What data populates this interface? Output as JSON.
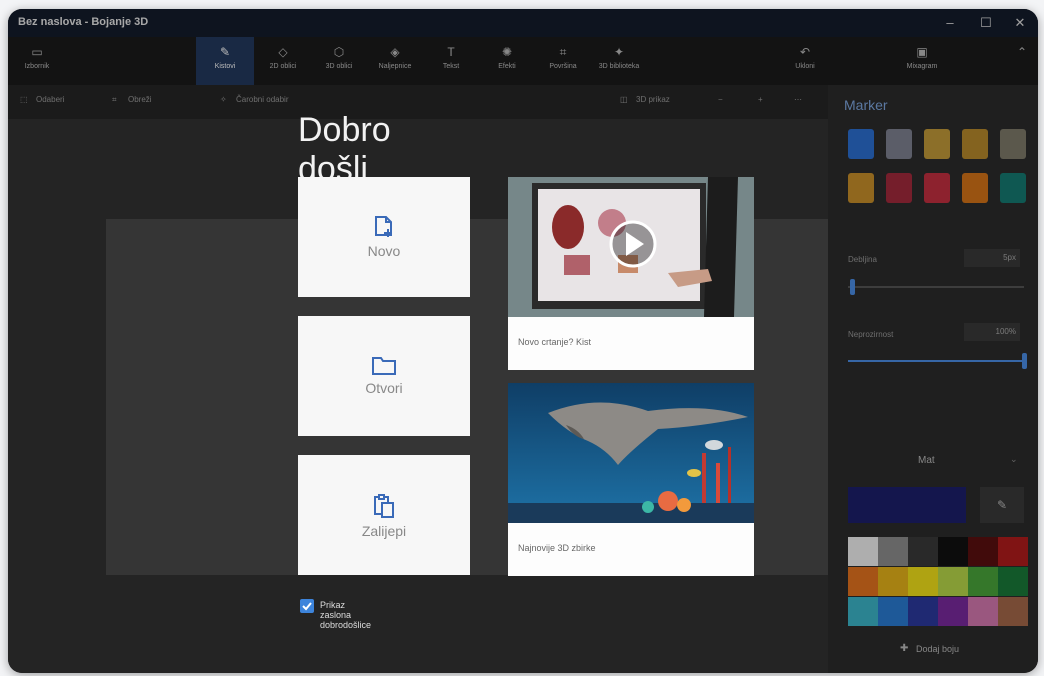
{
  "window": {
    "title": "Bez naslova - Bojanje 3D",
    "minimize": "–",
    "maximize": "☐",
    "close": "✕"
  },
  "ribbon": {
    "left_item": "Izbornik",
    "tools": [
      "Kistovi",
      "2D oblici",
      "3D oblici",
      "Naljepnice",
      "Tekst",
      "Efekti",
      "Površina",
      "3D biblioteka"
    ],
    "undo": "Ukloni",
    "right_item": "Mixagram"
  },
  "toolbar": {
    "items": [
      "Odaberi",
      "Obreži",
      "Čarobni odabir"
    ],
    "right_text": "3D prikaz"
  },
  "welcome": {
    "title": "Dobro došli",
    "cards": [
      {
        "label": "Novo",
        "icon": "new-file-icon"
      },
      {
        "label": "Otvori",
        "icon": "folder-icon"
      },
      {
        "label": "Zalijepi",
        "icon": "paste-icon"
      }
    ],
    "tiles": [
      {
        "caption": "Novo crtanje? Kist",
        "icon": "play-icon"
      },
      {
        "caption": "Najnovije 3D zbirke"
      }
    ],
    "checkbox_label": "Prikaz zaslona dobrodošlice",
    "checkbox_checked": true
  },
  "panel": {
    "heading": "Marker",
    "thickness_label": "Debljina",
    "thickness_value": "5px",
    "opacity_label": "Neprozirnost",
    "opacity_value": "100%",
    "finish": "Mat",
    "add_color": "Dodaj boju",
    "current_color": "#1c1f6b",
    "palette": [
      "#f2f2f2",
      "#8e8e8e",
      "#3a3a3a",
      "#111111",
      "#5b1010",
      "#b21d1d",
      "#e5731f",
      "#e7b31a",
      "#f3e21a",
      "#b9d84a",
      "#4aa63b",
      "#1a7a3a",
      "#3cb6c9",
      "#2a7cd3",
      "#2c3a9e",
      "#7a2a9e",
      "#d679b0",
      "#a6684a"
    ]
  }
}
